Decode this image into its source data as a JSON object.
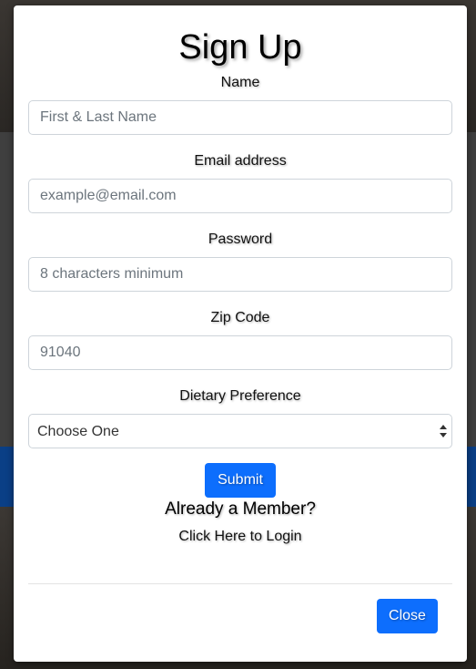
{
  "modal": {
    "title": "Sign Up",
    "fields": {
      "name": {
        "label": "Name",
        "placeholder": "First & Last Name"
      },
      "email": {
        "label": "Email address",
        "placeholder": "example@email.com"
      },
      "password": {
        "label": "Password",
        "placeholder": "8 characters minimum"
      },
      "zip": {
        "label": "Zip Code",
        "placeholder": "91040"
      },
      "dietary": {
        "label": "Dietary Preference",
        "selected": "Choose One"
      }
    },
    "submit_label": "Submit",
    "already_member": "Already a Member?",
    "login_link": "Click Here to Login",
    "close_label": "Close"
  },
  "colors": {
    "primary": "#0d6efd",
    "backdrop_band": "#0a3f86"
  },
  "icons": {
    "select": "select-arrows-icon"
  }
}
